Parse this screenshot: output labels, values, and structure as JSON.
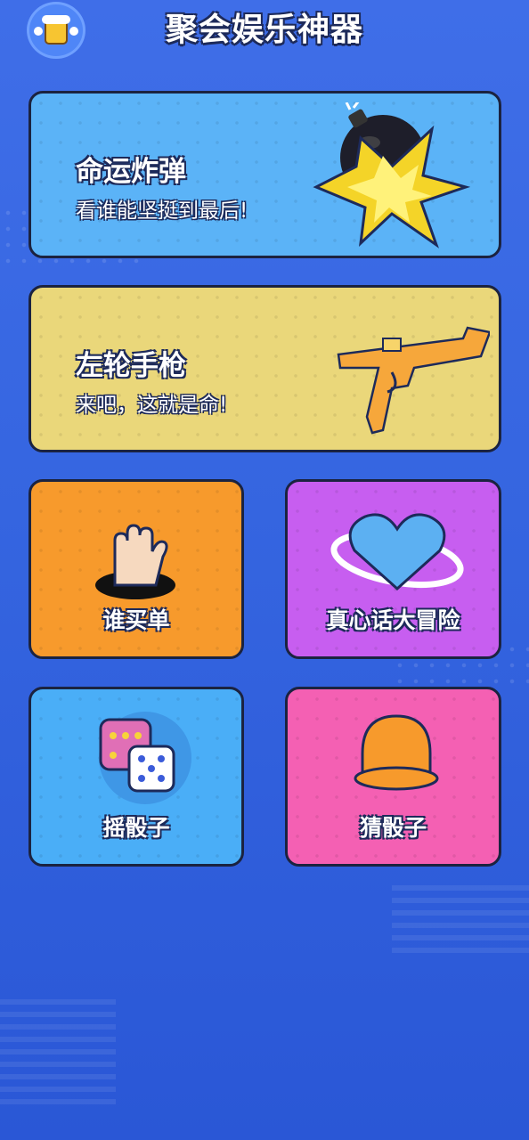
{
  "app": {
    "title": "聚会娱乐神器"
  },
  "cards": {
    "bomb": {
      "title": "命运炸弹",
      "subtitle": "看谁能坚挺到最后!",
      "color": "#5bb3f7",
      "icon": "bomb-icon"
    },
    "revolver": {
      "title": "左轮手枪",
      "subtitle": "来吧，这就是命!",
      "color": "#ead77a",
      "icon": "gun-icon"
    },
    "who_pays": {
      "label": "谁买单",
      "color": "#f79a2c",
      "icon": "raised-hand-icon"
    },
    "truth_or_dare": {
      "label": "真心话大冒险",
      "color": "#c75ef0",
      "icon": "heart-planet-icon"
    },
    "shake_dice": {
      "label": "摇骰子",
      "color": "#4aaef7",
      "icon": "dice-icon"
    },
    "guess_dice": {
      "label": "猜骰子",
      "color": "#f460b3",
      "icon": "dice-cup-icon"
    }
  }
}
